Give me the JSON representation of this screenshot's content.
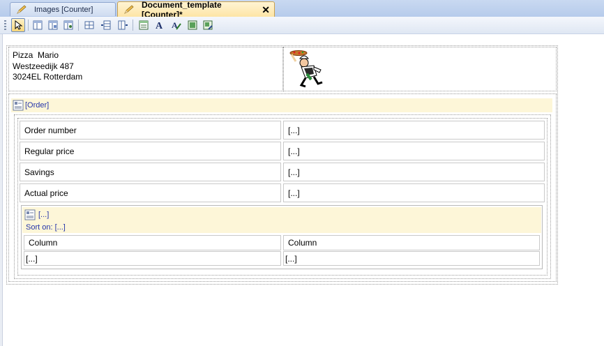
{
  "tabs": [
    {
      "label": "Images [Counter]",
      "active": false
    },
    {
      "label": "Document_template [Counter]*",
      "active": true
    }
  ],
  "toolbar": {
    "buttons": [
      "pointer-icon",
      "insert-table-icon",
      "insert-table-linked-icon",
      "insert-table-related-icon",
      "grid-icon",
      "insert-rows-icon",
      "insert-column-icon",
      "field-list-icon",
      "text-style-icon",
      "text-highlight-icon",
      "insert-image-icon",
      "image-properties-icon"
    ]
  },
  "header": {
    "address_lines": [
      "Pizza  Mario",
      "Westzeedijk 487",
      "3024EL Rotterdam"
    ],
    "logo": "pizza-chef-logo"
  },
  "order": {
    "label": "[Order]",
    "rows": [
      {
        "label": "Order number",
        "value": "[...]"
      },
      {
        "label": "Regular price",
        "value": "[...]"
      },
      {
        "label": "Savings",
        "value": "[...]"
      },
      {
        "label": "Actual price",
        "value": "[...]"
      }
    ],
    "subtable": {
      "label": "[...]",
      "sort_label": "Sort on: [...]",
      "columns": [
        "Column",
        "Column"
      ],
      "values": [
        "[...]",
        "[...]"
      ]
    }
  }
}
